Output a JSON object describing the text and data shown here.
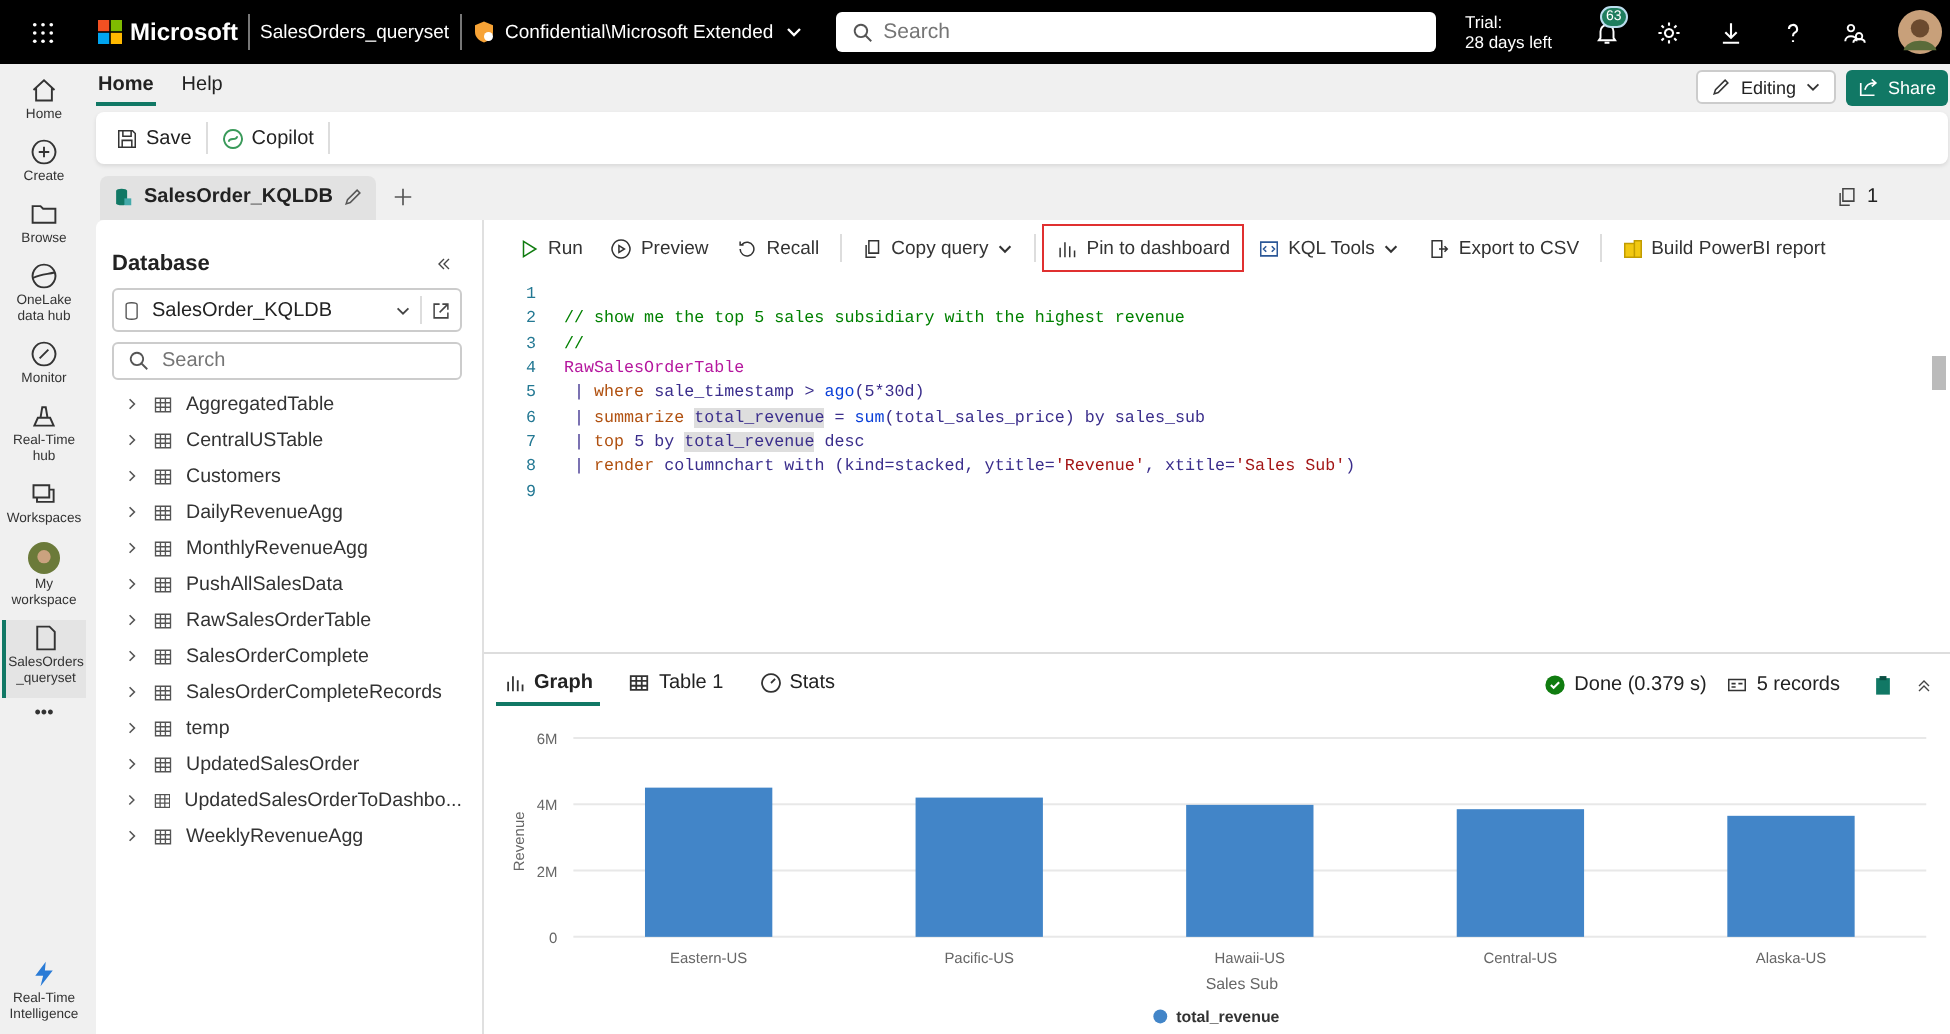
{
  "top_bar": {
    "brand": "Microsoft",
    "item_name": "SalesOrders_queryset",
    "sensitivity": "Confidential\\Microsoft Extended",
    "search": {
      "placeholder": "Search"
    },
    "trial": {
      "title": "Trial:",
      "days": "28 days left"
    },
    "notifications": "63"
  },
  "rail": {
    "items": [
      {
        "label": "Home",
        "kind": "icon",
        "selected": false
      },
      {
        "label": "Create",
        "kind": "icon",
        "selected": false
      },
      {
        "label": "Browse",
        "kind": "icon",
        "selected": false
      },
      {
        "label": "OneLake data hub",
        "kind": "icon",
        "selected": false
      },
      {
        "label": "Monitor",
        "kind": "icon",
        "selected": false
      },
      {
        "label": "Real-Time hub",
        "kind": "icon",
        "selected": false
      },
      {
        "label": "Workspaces",
        "kind": "icon",
        "selected": false
      },
      {
        "label": "My workspace",
        "kind": "avatar",
        "selected": false
      },
      {
        "label": "SalesOrders _queryset",
        "kind": "icon",
        "selected": true
      },
      {
        "label": "•••",
        "kind": "more",
        "selected": false
      }
    ],
    "footer": "Real-Time Intelligence"
  },
  "ribbon": {
    "tabs": [
      {
        "label": "Home",
        "selected": true
      },
      {
        "label": "Help",
        "selected": false
      }
    ],
    "mode": "Editing",
    "share": "Share",
    "actions": [
      "Save",
      "Copilot"
    ]
  },
  "doc_tabs": {
    "tabs": [
      {
        "label": "SalesOrder_KQLDB",
        "selected": true
      }
    ],
    "count": "1"
  },
  "database": {
    "title": "Database",
    "selected": "SalesOrder_KQLDB",
    "search": {
      "placeholder": "Search"
    },
    "tables": [
      {
        "name": "AggregatedTable",
        "expanded": false
      },
      {
        "name": "CentralUSTable",
        "expanded": false
      },
      {
        "name": "Customers",
        "expanded": false
      },
      {
        "name": "DailyRevenueAgg",
        "expanded": false
      },
      {
        "name": "MonthlyRevenueAgg",
        "expanded": false
      },
      {
        "name": "PushAllSalesData",
        "expanded": false
      },
      {
        "name": "RawSalesOrderTable",
        "expanded": false
      },
      {
        "name": "SalesOrderComplete",
        "expanded": false
      },
      {
        "name": "SalesOrderCompleteRecords",
        "expanded": false
      },
      {
        "name": "temp",
        "expanded": false
      },
      {
        "name": "UpdatedSalesOrder",
        "expanded": false
      },
      {
        "name": "UpdatedSalesOrderToDashbo...",
        "expanded": false
      },
      {
        "name": "WeeklyRevenueAgg",
        "expanded": false
      }
    ]
  },
  "editor": {
    "toolbar": [
      {
        "label": "Run",
        "dropdown": false,
        "highlighted": false
      },
      {
        "label": "Preview",
        "dropdown": false,
        "highlighted": false
      },
      {
        "label": "Recall",
        "dropdown": false,
        "highlighted": false
      },
      {
        "label": "Copy query",
        "dropdown": true,
        "highlighted": false
      },
      {
        "label": "Pin to dashboard",
        "dropdown": false,
        "highlighted": true
      },
      {
        "label": "KQL Tools",
        "dropdown": true,
        "highlighted": false
      },
      {
        "label": "Export to CSV",
        "dropdown": false,
        "highlighted": false
      },
      {
        "label": "Build PowerBI report",
        "dropdown": false,
        "highlighted": false
      }
    ],
    "lines": [
      {
        "n": "1"
      },
      {
        "n": "2",
        "tokens": [
          {
            "text": "// show me the top 5 sales subsidiary with the highest revenue",
            "kind": "comment"
          }
        ]
      },
      {
        "n": "3",
        "tokens": [
          {
            "text": "//",
            "kind": "comment"
          }
        ]
      },
      {
        "n": "4",
        "tokens": [
          {
            "text": "RawSalesOrderTable",
            "kind": "table"
          }
        ]
      },
      {
        "n": "5",
        "tokens": [
          {
            "text": " | ",
            "kind": "plain"
          },
          {
            "text": "where",
            "kind": "keyword"
          },
          {
            "text": " sale_timestamp > ",
            "kind": "plain"
          },
          {
            "text": "ago",
            "kind": "function"
          },
          {
            "text": "(5*30d)",
            "kind": "plain"
          }
        ]
      },
      {
        "n": "6",
        "tokens": [
          {
            "text": " | ",
            "kind": "plain"
          },
          {
            "text": "summarize ",
            "kind": "keyword"
          },
          {
            "text": "total_revenue",
            "kind": "match"
          },
          {
            "text": " = ",
            "kind": "plain"
          },
          {
            "text": "sum",
            "kind": "function"
          },
          {
            "text": "(total_sales_price) by sales_sub",
            "kind": "plain"
          }
        ]
      },
      {
        "n": "7",
        "tokens": [
          {
            "text": " | ",
            "kind": "plain"
          },
          {
            "text": "top",
            "kind": "keyword"
          },
          {
            "text": " 5 by ",
            "kind": "plain"
          },
          {
            "text": "total_revenue",
            "kind": "match"
          },
          {
            "text": " desc",
            "kind": "plain"
          }
        ]
      },
      {
        "n": "8",
        "tokens": [
          {
            "text": " | ",
            "kind": "plain"
          },
          {
            "text": "render",
            "kind": "keyword"
          },
          {
            "text": " columnchart with (kind=stacked, ytitle=",
            "kind": "plain"
          },
          {
            "text": "'Revenue'",
            "kind": "string"
          },
          {
            "text": ", xtitle=",
            "kind": "plain"
          },
          {
            "text": "'Sales Sub'",
            "kind": "string"
          },
          {
            "text": ")",
            "kind": "plain"
          }
        ]
      },
      {
        "n": "9"
      }
    ]
  },
  "results": {
    "tabs": [
      {
        "label": "Graph",
        "selected": true
      },
      {
        "label": "Table 1",
        "selected": false
      },
      {
        "label": "Stats",
        "selected": false
      }
    ],
    "status": "Done (0.379 s)",
    "records": "5 records",
    "chart_data": {
      "type": "bar",
      "xlabel": "Sales Sub",
      "ylabel": "Revenue",
      "categories": [
        "Eastern-US",
        "Pacific-US",
        "Hawaii-US",
        "Central-US",
        "Alaska-US"
      ],
      "series": [
        {
          "name": "total_revenue",
          "color": "#4285c8",
          "values": [
            4500000,
            4200000,
            3980000,
            3850000,
            3650000
          ]
        }
      ],
      "ylim": [
        0,
        6000000
      ],
      "yticks": [
        {
          "value": 0,
          "label": "0"
        },
        {
          "value": 2000000,
          "label": "2M"
        },
        {
          "value": 4000000,
          "label": "4M"
        },
        {
          "value": 6000000,
          "label": "6M"
        }
      ]
    }
  }
}
